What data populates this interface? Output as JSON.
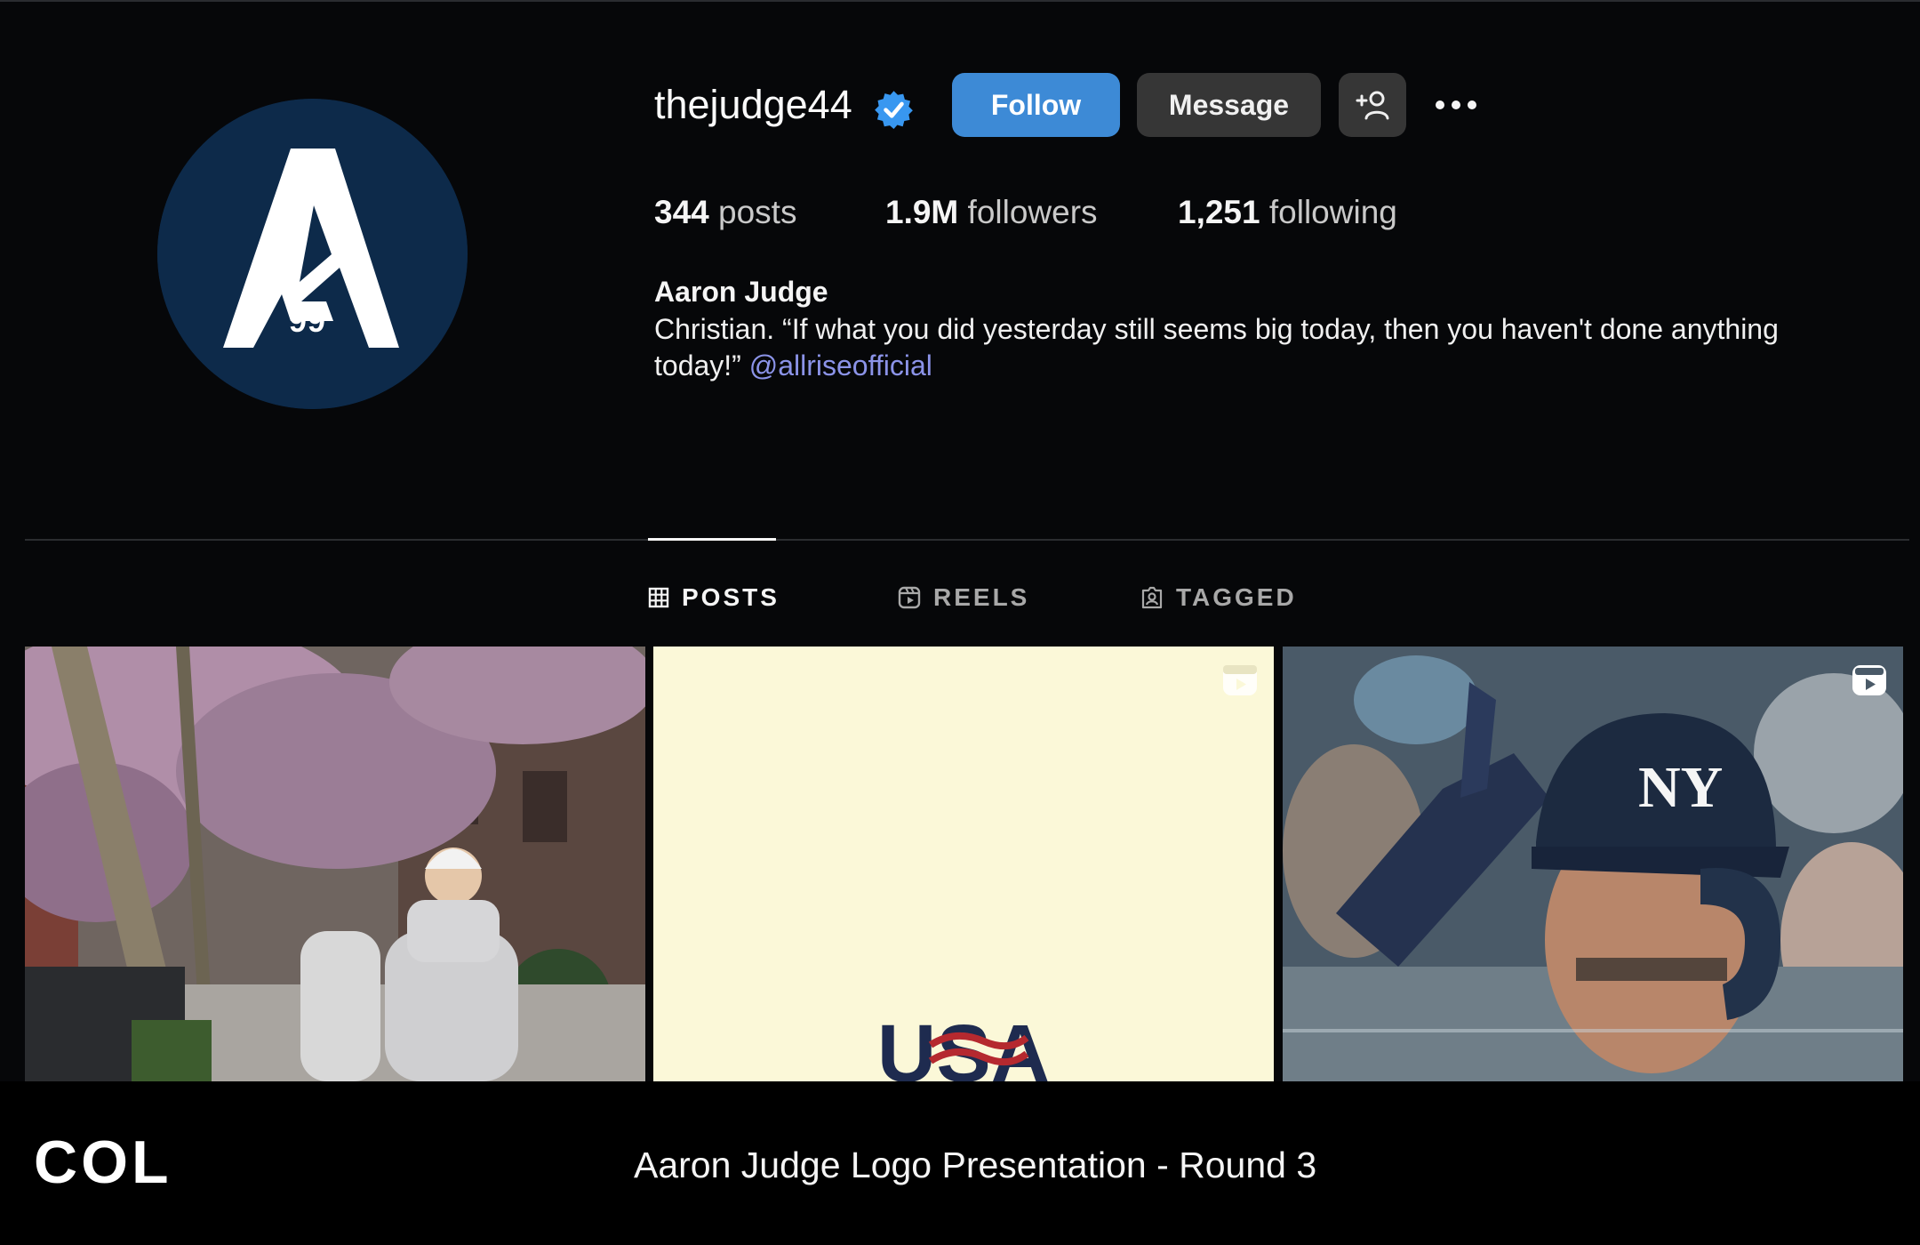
{
  "profile": {
    "username": "thejudge44",
    "verified": true,
    "avatar_icon": "a99-logo",
    "accent_color": "#3d8ad6"
  },
  "actions": {
    "follow_label": "Follow",
    "message_label": "Message",
    "add_user_icon": "person-plus-icon",
    "more_icon": "ellipsis-icon"
  },
  "stats": {
    "posts_count": "344",
    "posts_label": "posts",
    "followers_count": "1.9M",
    "followers_label": "followers",
    "following_count": "1,251",
    "following_label": "following"
  },
  "bio": {
    "full_name": "Aaron Judge",
    "text": "Christian. “If what you did yesterday still seems big today, then you haven't done anything today!”",
    "link": "@allriseofficial"
  },
  "tabs": [
    {
      "label": "POSTS",
      "icon": "grid-icon",
      "active": true
    },
    {
      "label": "REELS",
      "icon": "reels-icon",
      "active": false
    },
    {
      "label": "TAGGED",
      "icon": "tagged-icon",
      "active": false
    }
  ],
  "posts": [
    {
      "kind": "photo",
      "reel": false
    },
    {
      "kind": "reel",
      "reel": true,
      "text": "USA"
    },
    {
      "kind": "reel",
      "reel": true
    }
  ],
  "footer": {
    "logo": "COL",
    "caption": "Aaron Judge Logo Presentation - Round 3"
  }
}
